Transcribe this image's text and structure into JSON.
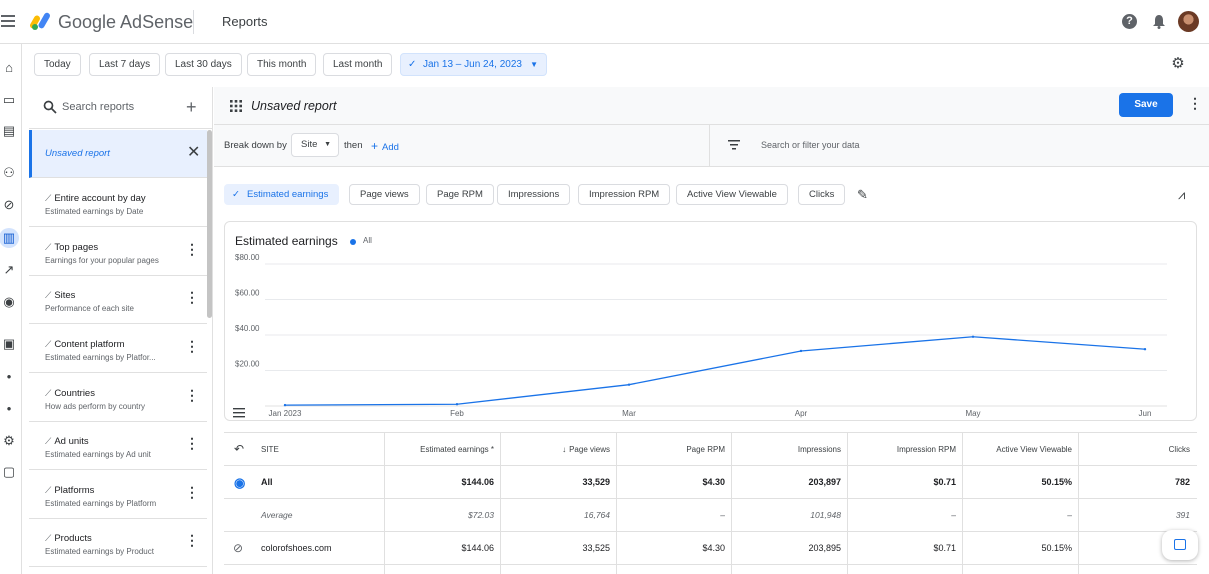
{
  "app": {
    "brand": "Google AdSense",
    "page_title": "Reports"
  },
  "topbar": {
    "help_icon": "help-circle-icon",
    "help_glyph": "?",
    "bell_icon": "notifications-bell-icon"
  },
  "rail": {
    "icons": [
      "home-icon",
      "ads-icon",
      "sites-icon",
      "users-icon",
      "block-icon",
      "reports-icon",
      "optimization-icon",
      "privacy-icon",
      "payments-icon",
      "dot-icon",
      "dot-icon",
      "settings-icon",
      "feedback-icon"
    ],
    "active": "reports-icon"
  },
  "date_filters": {
    "options": [
      "Today",
      "Last 7 days",
      "Last 30 days",
      "This month",
      "Last month"
    ],
    "selected_range": "Jan 13 – Jun 24, 2023"
  },
  "sidebar": {
    "search_placeholder": "Search reports",
    "add_glyph": "+",
    "items": [
      {
        "title": "Unsaved report",
        "subtitle": "",
        "active": true
      },
      {
        "title": "Entire account by day",
        "subtitle": "Estimated earnings by Date"
      },
      {
        "title": "Top pages",
        "subtitle": "Earnings for your popular pages"
      },
      {
        "title": "Sites",
        "subtitle": "Performance of each site"
      },
      {
        "title": "Content platform",
        "subtitle": "Estimated earnings by Platfor..."
      },
      {
        "title": "Countries",
        "subtitle": "How ads perform by country"
      },
      {
        "title": "Ad units",
        "subtitle": "Estimated earnings by Ad unit"
      },
      {
        "title": "Platforms",
        "subtitle": "Estimated earnings by Platform"
      },
      {
        "title": "Products",
        "subtitle": "Estimated earnings by Product"
      }
    ]
  },
  "report": {
    "name": "Unsaved report",
    "save_label": "Save",
    "breakdown_label": "Break down by",
    "breakdown_value": "Site",
    "then_label": "then",
    "add_label": "Add",
    "filter_placeholder": "Search or filter your data"
  },
  "metrics": {
    "chips": [
      "Estimated earnings",
      "Page views",
      "Page RPM",
      "Impressions",
      "Impression RPM",
      "Active View Viewable",
      "Clicks"
    ],
    "selected": "Estimated earnings"
  },
  "chart_data": {
    "type": "line",
    "title": "Estimated earnings",
    "series": [
      {
        "name": "All",
        "color": "#1a73e8",
        "x": [
          "2023-01-01",
          "2023-02-01",
          "2023-03-01",
          "2023-04-01",
          "2023-05-01",
          "2023-06-01"
        ],
        "values": [
          0.5,
          1,
          12,
          31,
          39,
          32
        ]
      }
    ],
    "x_tick_labels": [
      "Jan 2023",
      "Feb",
      "Mar",
      "Apr",
      "May",
      "Jun"
    ],
    "y_tick_labels": [
      "$20.00",
      "$40.00",
      "$60.00",
      "$80.00"
    ],
    "y_ticks": [
      20,
      40,
      60,
      80
    ],
    "ylim": [
      0,
      80
    ],
    "grid": true
  },
  "table": {
    "columns": [
      "SITE",
      "Estimated earnings",
      "Page views",
      "Page RPM",
      "Impressions",
      "Impression RPM",
      "Active View Viewable",
      "Clicks"
    ],
    "rows": [
      {
        "site": "All",
        "values": [
          "$144.06",
          "33,529",
          "$4.30",
          "203,897",
          "$0.71",
          "50.15%",
          "782"
        ]
      },
      {
        "site": "Average",
        "values": [
          "$72.03",
          "16,764",
          "–",
          "101,948",
          "–",
          "–",
          "391"
        ]
      },
      {
        "site": "colorofshoes.com",
        "values": [
          "$144.06",
          "33,525",
          "$4.30",
          "203,895",
          "$0.71",
          "50.15%",
          ""
        ]
      }
    ]
  }
}
